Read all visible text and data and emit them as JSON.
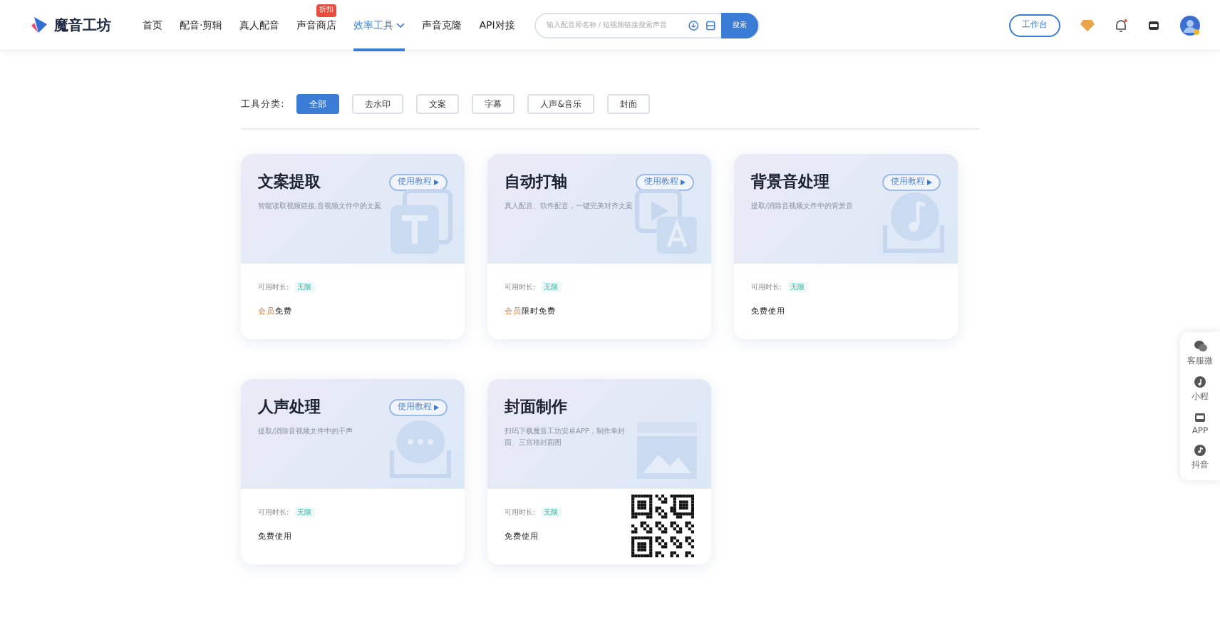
{
  "header": {
    "logo": "魔音工坊",
    "nav": [
      {
        "label": "首页",
        "selected": false
      },
      {
        "label": "配音·剪辑",
        "selected": false
      },
      {
        "label": "真人配音",
        "selected": false
      },
      {
        "label": "声音商店",
        "selected": false,
        "badge": "折扣"
      },
      {
        "label": "效率工具",
        "selected": true,
        "dropdown": true
      },
      {
        "label": "声音克隆",
        "selected": false
      },
      {
        "label": "API对接",
        "selected": false
      }
    ],
    "search": {
      "placeholder": "输入配音师名称 / 短视频链接搜索声音",
      "button": "搜索"
    },
    "workbench": "工作台"
  },
  "filter": {
    "label": "工具分类:",
    "options": [
      {
        "label": "全部",
        "selected": true
      },
      {
        "label": "去水印",
        "selected": false
      },
      {
        "label": "文案",
        "selected": false
      },
      {
        "label": "字幕",
        "selected": false
      },
      {
        "label": "人声&音乐",
        "selected": false
      },
      {
        "label": "封面",
        "selected": false
      }
    ]
  },
  "tools": [
    {
      "title": "文案提取",
      "kind": "text",
      "tutorial": "使用教程",
      "desc": "智能读取视频链接,音视频文件中的文案",
      "duration_label": "可用时长:",
      "duration": "无限",
      "note_highlight": "会员",
      "note": "免费"
    },
    {
      "title": "自动打轴",
      "kind": "subtitle",
      "tutorial": "使用教程",
      "desc": "真人配音、软件配音，一键完美对齐文案",
      "duration_label": "可用时长:",
      "duration": "无限",
      "note_highlight": "会员",
      "note": "限时免费"
    },
    {
      "title": "背景音处理",
      "kind": "music",
      "tutorial": "使用教程",
      "desc": "提取/消除音视频文件中的背景音",
      "duration_label": "可用时长:",
      "duration": "无限",
      "note": "免费使用"
    },
    {
      "title": "人声处理",
      "kind": "voice",
      "tutorial": "使用教程",
      "desc": "提取/消除音视频文件中的干声",
      "duration_label": "可用时长:",
      "duration": "无限",
      "note": "免费使用"
    },
    {
      "title": "封面制作",
      "kind": "cover",
      "desc": "扫码下载魔音工坊安卓APP，制作单封面、三宫格封面图",
      "duration_label": "可用时长:",
      "duration": "无限",
      "note": "免费使用",
      "qr": true
    }
  ],
  "side_panel": [
    {
      "label": "客服微",
      "kind": "chat"
    },
    {
      "label": "小程",
      "kind": "mini"
    },
    {
      "label": "APP",
      "kind": "app"
    },
    {
      "label": "抖音",
      "kind": "douyin"
    }
  ]
}
